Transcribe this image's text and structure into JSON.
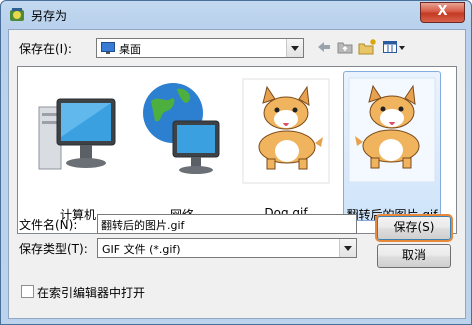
{
  "window": {
    "title": "另存为",
    "close_label": "X"
  },
  "save_in": {
    "label": "保存在(I):",
    "value": "桌面"
  },
  "toolbar": {
    "back_icon": "back-arrow-icon",
    "up_icon": "up-folder-icon",
    "new_folder_icon": "new-folder-icon",
    "view_icon": "view-menu-icon"
  },
  "files": [
    {
      "name": "计算机",
      "icon": "computer-icon"
    },
    {
      "name": "网络",
      "icon": "network-icon"
    },
    {
      "name": "Dog.gif",
      "icon": "corgi-thumbnail"
    },
    {
      "name": "翻转后的图片.gif",
      "icon": "corgi-thumbnail",
      "selected": true
    }
  ],
  "filename": {
    "label": "文件名(N):",
    "value": "翻转后的图片.gif"
  },
  "filetype": {
    "label": "保存类型(T):",
    "value": "GIF 文件 (*.gif)"
  },
  "buttons": {
    "save": "保存(S)",
    "cancel": "取消"
  },
  "open_in_index_editor": {
    "label": "在索引编辑器中打开",
    "checked": false
  }
}
